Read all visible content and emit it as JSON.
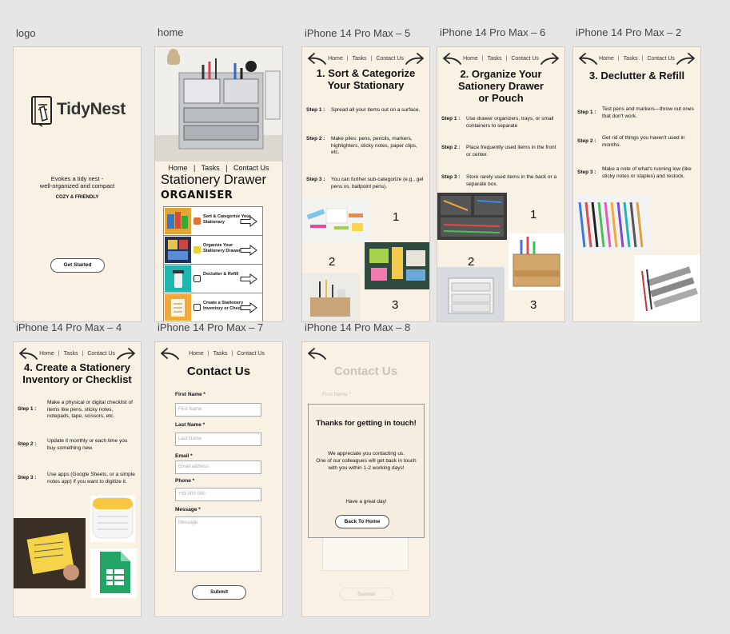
{
  "colors": {
    "frame_bg": "#f8f1e4",
    "canvas_bg": "#e6e6e6"
  },
  "frame_labels": {
    "logo": "logo",
    "home": "home",
    "f5": "iPhone 14 Pro Max – 5",
    "f6": "iPhone 14 Pro Max – 6",
    "f2": "iPhone 14 Pro Max – 2",
    "f4": "iPhone 14 Pro Max – 4",
    "f7": "iPhone 14 Pro Max – 7",
    "f8": "iPhone 14 Pro Max – 8"
  },
  "nav": {
    "home": "Home",
    "tasks": "Tasks",
    "contact": "Contact Us"
  },
  "logo": {
    "brand": "TidyNest",
    "tagline1": "Evokes a tidy nest -",
    "tagline2": "well-organized and compact",
    "tagline3": "COZY & FRIENDLY",
    "cta": "Get Started"
  },
  "home": {
    "title": "Stationery Drawer",
    "subtitle": "ORGANISER",
    "cards": [
      {
        "label": "Sort & Categorize Your Stationary"
      },
      {
        "label": "Organize Your Stationery Drawer"
      },
      {
        "label": "Declutter & Refill"
      },
      {
        "label": "Create a Stationery Inventory or Checklist"
      }
    ]
  },
  "f5": {
    "title": "1. Sort & Categorize Your Stationary",
    "steps": [
      {
        "label": "Step 1 :",
        "text": "Spread all your items out on a surface."
      },
      {
        "label": "Step 2 :",
        "text": "Make piles: pens, pencils, markers, highlighters, sticky notes, paper clips, etc."
      },
      {
        "label": "Step 3 :",
        "text": "You can further sub-categorize (e.g., gel pens vs. ballpoint pens)."
      }
    ],
    "nums": [
      "1",
      "2",
      "3"
    ]
  },
  "f6": {
    "title": "2. Organize Your Sationery Drawer or Pouch",
    "steps": [
      {
        "label": "Step 1 :",
        "text": "Use drawer organizers, trays, or small containers to separate"
      },
      {
        "label": "Step 2 :",
        "text": "Place frequently used items in the front or center."
      },
      {
        "label": "Step 3 :",
        "text": "Store rarely used items in the back or a separate box."
      }
    ],
    "nums": [
      "1",
      "2",
      "3"
    ]
  },
  "f2": {
    "title": "3. Declutter & Refill",
    "steps": [
      {
        "label": "Step 1 :",
        "text": "Test pens and markers—throw out ones that don't work."
      },
      {
        "label": "Step 2 :",
        "text": "Get rid of things you haven't used in months."
      },
      {
        "label": "Step 3 :",
        "text": "Make a note of what's running low (like sticky notes or staples) and restock."
      }
    ]
  },
  "f4": {
    "title": "4. Create a Stationery Inventory or Checklist",
    "steps": [
      {
        "label": "Step 1 :",
        "text": "Make a physical or digital checklist of items like pens, sticky notes, notepads, tape, scissors, etc."
      },
      {
        "label": "Step 2 :",
        "text": "Update it monthly or each time you buy something new."
      },
      {
        "label": "Step 3 :",
        "text": "Use apps (Google Sheets, or a simple notes app) if you want to digitize it."
      }
    ]
  },
  "f7": {
    "title": "Contact Us",
    "fields": [
      {
        "label": "First Name *",
        "placeholder": "First Name"
      },
      {
        "label": "Last Name *",
        "placeholder": "Last Name"
      },
      {
        "label": "Email *",
        "placeholder": "Email address"
      },
      {
        "label": "Phone *",
        "placeholder": "+65 000 000"
      }
    ],
    "message_label": "Message *",
    "message_placeholder": "Message",
    "submit": "Submit"
  },
  "f8": {
    "title": "Contact Us",
    "first_label": "First Name *",
    "dialog_title": "Thanks for getting in touch!",
    "dialog_body1": "We appreciate you contacting us.",
    "dialog_body2": "One of our colleagues will get back in touch",
    "dialog_body3": "with you within 1-2 working days!",
    "dialog_bye": "Have a great day!",
    "back": "Back To Home",
    "submit": "Submit"
  }
}
